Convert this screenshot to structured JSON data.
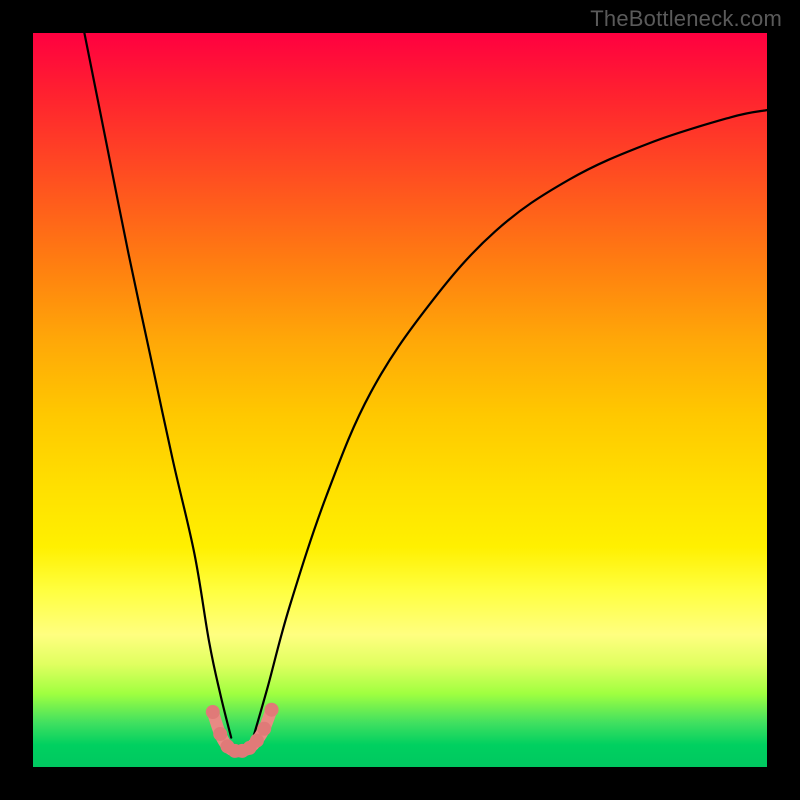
{
  "watermark": "TheBottleneck.com",
  "chart_data": {
    "type": "line",
    "title": "",
    "xlabel": "",
    "ylabel": "",
    "xlim": [
      0,
      100
    ],
    "ylim": [
      0,
      100
    ],
    "grid": false,
    "legend": false,
    "notes": "Bottleneck-style chart: vertical gradient background (red top → green bottom) representing bottleneck severity; two black curves descend into a narrow valley near x≈28 where a short salmon-pink segment highlights the minimum (optimal match). Left curve falls steeply from top-left; right curve rises with diminishing slope toward the right edge.",
    "series": [
      {
        "name": "left-curve",
        "x": [
          7,
          10,
          13,
          16,
          19,
          22,
          24,
          25.5,
          27
        ],
        "y": [
          100,
          85,
          70,
          56,
          42,
          29,
          17,
          10,
          4
        ]
      },
      {
        "name": "right-curve",
        "x": [
          30,
          32,
          35,
          40,
          46,
          54,
          63,
          73,
          84,
          95,
          100
        ],
        "y": [
          4,
          11,
          22,
          37,
          51,
          63,
          73,
          80,
          85,
          88.5,
          89.5
        ]
      },
      {
        "name": "valley-highlight",
        "color": "#e98a84",
        "x": [
          24.5,
          25.5,
          26.5,
          27.5,
          28.5,
          29.5,
          30.5,
          31.5,
          32.5
        ],
        "y": [
          7.5,
          4.5,
          2.8,
          2.2,
          2.2,
          2.6,
          3.6,
          5.2,
          7.8
        ]
      }
    ],
    "background_gradient": {
      "top": "#ff0040",
      "middle": "#ffe000",
      "bottom": "#00c860"
    }
  }
}
